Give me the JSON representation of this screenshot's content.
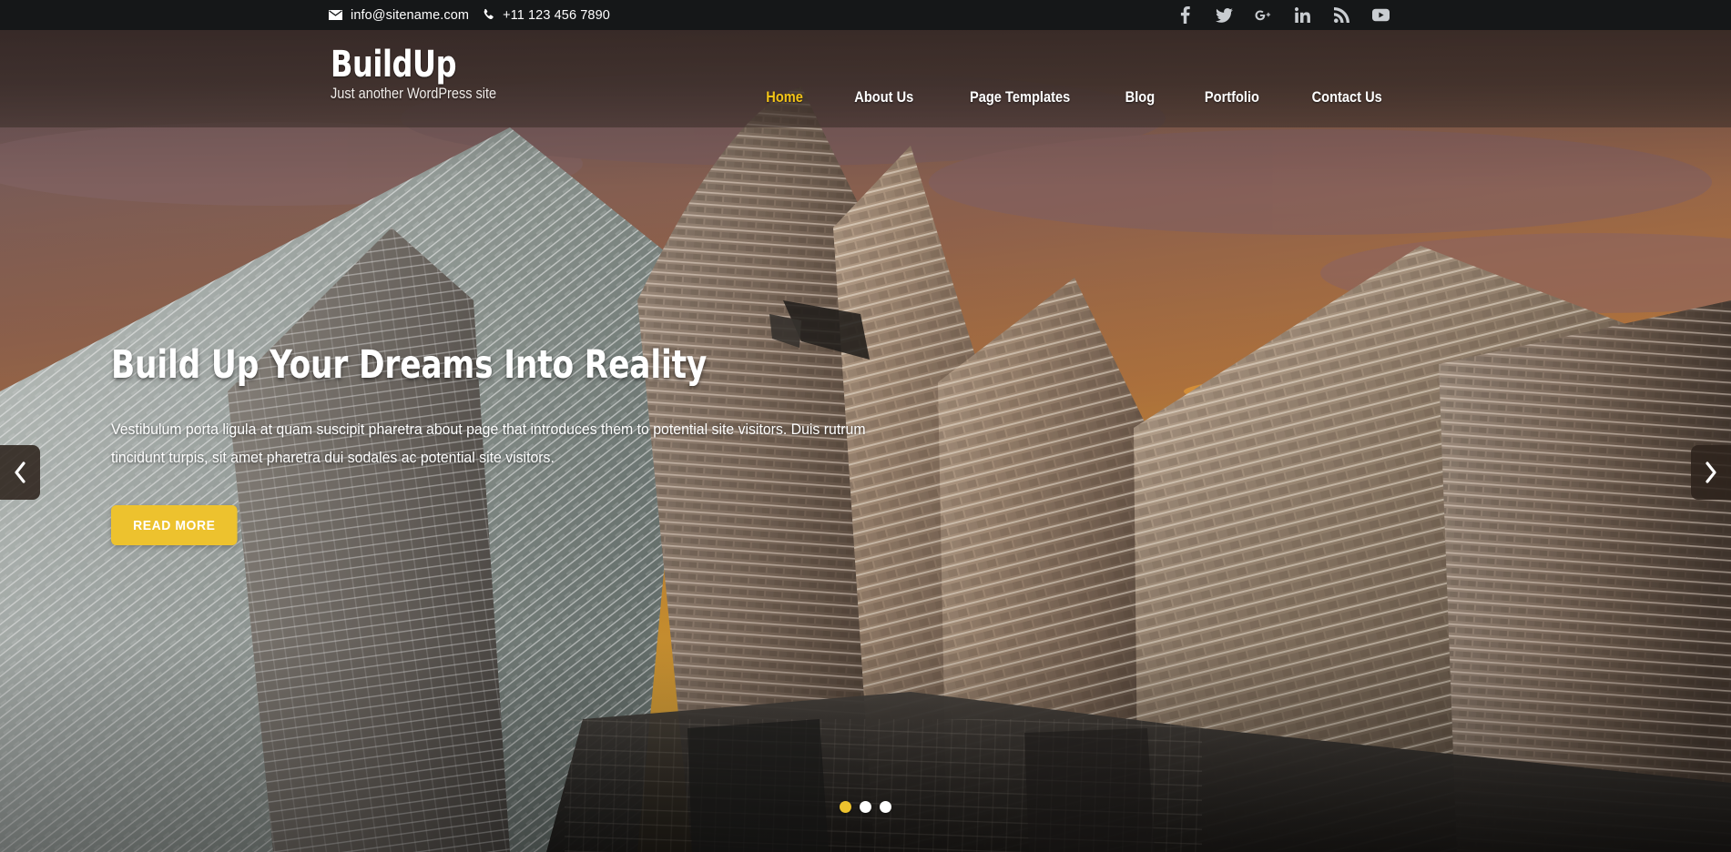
{
  "topbar": {
    "email": "info@sitename.com",
    "phone": "+11 123 456 7890",
    "email_icon": "envelope-icon",
    "phone_icon": "phone-icon",
    "social": [
      {
        "name": "facebook-icon",
        "label": "Facebook"
      },
      {
        "name": "twitter-icon",
        "label": "Twitter"
      },
      {
        "name": "google-plus-icon",
        "label": "Google Plus"
      },
      {
        "name": "linkedin-icon",
        "label": "LinkedIn"
      },
      {
        "name": "rss-icon",
        "label": "RSS"
      },
      {
        "name": "youtube-icon",
        "label": "YouTube"
      }
    ]
  },
  "header": {
    "site_title": "BuildUp",
    "tagline": "Just another WordPress site",
    "nav": [
      {
        "label": "Home",
        "active": true
      },
      {
        "label": "About Us",
        "active": false
      },
      {
        "label": "Page Templates",
        "active": false
      },
      {
        "label": "Blog",
        "active": false
      },
      {
        "label": "Portfolio",
        "active": false
      },
      {
        "label": "Contact Us",
        "active": false
      }
    ]
  },
  "hero": {
    "title": "Build Up Your Dreams Into Reality",
    "description": "Vestibulum porta ligula at quam suscipit pharetra about page that introduces them to potential site visitors. Duis rutrum tincidunt turpis, sit amet pharetra dui sodales ac potential site visitors.",
    "button_label": "READ MORE",
    "prev_label": "Previous slide",
    "next_label": "Next slide",
    "slides_total": 3,
    "active_slide": 1,
    "image_description": "Low-angle photograph of modern glass skyscrapers against an orange and purple sunset sky"
  },
  "colors": {
    "accent": "#edc22e",
    "nav_active": "#f3c417",
    "topbar_bg": "#151718",
    "header_overlay": "#302420",
    "text_light": "#ffffff",
    "social_icon": "#c9cdd1",
    "arrow_bg": "#2d231c"
  }
}
